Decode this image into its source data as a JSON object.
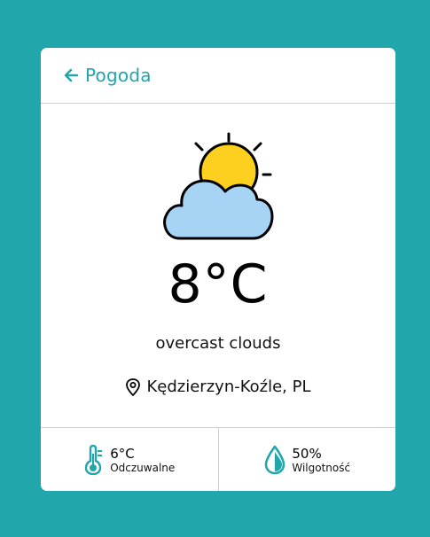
{
  "header": {
    "back_label": "Pogoda"
  },
  "weather": {
    "icon": "partly-cloudy-icon",
    "temperature": "8°C",
    "description": "overcast clouds",
    "location": "Kędzierzyn-Koźle, PL"
  },
  "stats": {
    "feels_like": {
      "value": "6°C",
      "label": "Odczuwalne",
      "icon": "thermometer-icon"
    },
    "humidity": {
      "value": "50%",
      "label": "Wilgotność",
      "icon": "water-drop-icon"
    }
  },
  "colors": {
    "background": "#21a6ac",
    "accent": "#21a6ac",
    "sun": "#fdd01f",
    "cloud": "#a7d3f5"
  }
}
